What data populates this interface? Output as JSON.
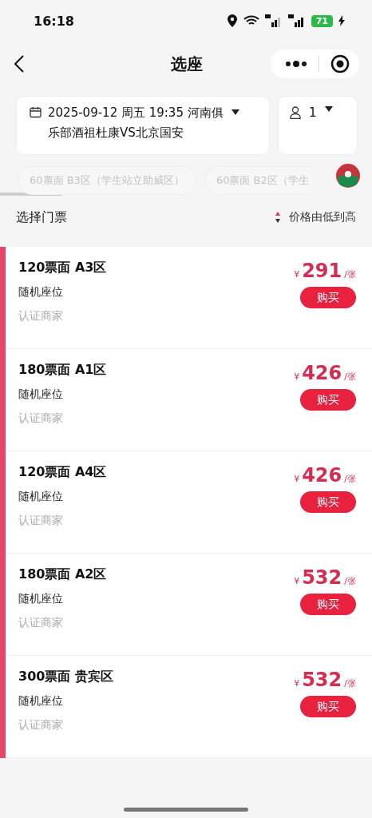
{
  "status_bar": {
    "time": "16:18",
    "battery": "71"
  },
  "nav": {
    "title": "选座"
  },
  "match_selector": {
    "text": "2025-09-12 周五 19:35 河南俱乐部酒祖杜康VS北京国安"
  },
  "quantity_selector": {
    "value": "1"
  },
  "zone_chips": [
    {
      "label": "60票面 B3区（学生站立助威区）"
    },
    {
      "label": "60票面 B2区（学生"
    }
  ],
  "list_header": {
    "title": "选择门票",
    "sort": "价格由低到高"
  },
  "tickets": [
    {
      "name": "120票面 A3区",
      "seat": "随机座位",
      "seller": "认证商家",
      "currency": "¥",
      "price": "291",
      "unit": "/张",
      "button": "购买"
    },
    {
      "name": "180票面 A1区",
      "seat": "随机座位",
      "seller": "认证商家",
      "currency": "¥",
      "price": "426",
      "unit": "/张",
      "button": "购买"
    },
    {
      "name": "120票面 A4区",
      "seat": "随机座位",
      "seller": "认证商家",
      "currency": "¥",
      "price": "426",
      "unit": "/张",
      "button": "购买"
    },
    {
      "name": "180票面 A2区",
      "seat": "随机座位",
      "seller": "认证商家",
      "currency": "¥",
      "price": "532",
      "unit": "/张",
      "button": "购买"
    },
    {
      "name": "300票面 贵宾区",
      "seat": "随机座位",
      "seller": "认证商家",
      "currency": "¥",
      "price": "532",
      "unit": "/张",
      "button": "购买"
    }
  ]
}
